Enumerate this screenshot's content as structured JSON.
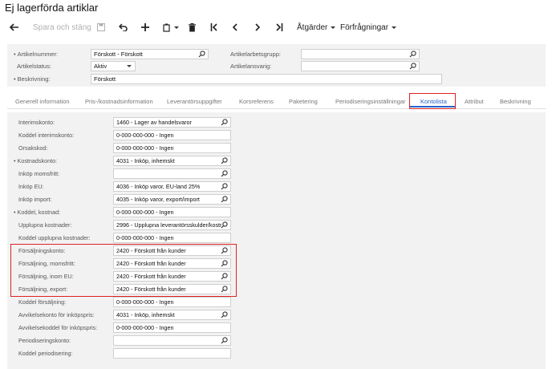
{
  "page": {
    "title": "Ej lagerförda artiklar"
  },
  "toolbar": {
    "save_close": "Spara och stäng",
    "actions": "Åtgärder",
    "inquiries": "Förfrågningar"
  },
  "header": {
    "article_number_label": "Artikelnummer:",
    "article_number_value": "Förskott - Förskott",
    "article_status_label": "Artikelstatus:",
    "article_status_value": "Aktiv",
    "description_label": "Beskrivning:",
    "description_value": "Förskott",
    "work_group_label": "Artikelarbetsgrupp:",
    "responsible_label": "Artikelansvarig:"
  },
  "tabs": [
    {
      "label": "Generell information"
    },
    {
      "label": "Pris-/kostnadsinformation"
    },
    {
      "label": "Leverantörsuppgifter"
    },
    {
      "label": "Korsreferens"
    },
    {
      "label": "Paketering"
    },
    {
      "label": "Periodiseringsinställningar"
    },
    {
      "label": "Kontolista",
      "active": true
    },
    {
      "label": "Attribut"
    },
    {
      "label": "Beskrivning"
    }
  ],
  "fields": [
    {
      "label": "Interimskonto:",
      "value": "1460 - Lager av handelsvaror",
      "search": true
    },
    {
      "label": "Koddel interimskonto:",
      "value": "0-000-000-000 - Ingen"
    },
    {
      "label": "Orsakskod:",
      "value": "0-000-000-000 - Ingen"
    },
    {
      "label": "Kostnadskonto:",
      "value": "4031 - Inköp, inhemskt",
      "search": true,
      "required": true
    },
    {
      "label": "Inköp momsfritt:",
      "value": "",
      "search": true
    },
    {
      "label": "Inköp EU:",
      "value": "4036 - Inköp varor, EU-land 25%",
      "search": true
    },
    {
      "label": "Inköp import:",
      "value": "4035 - Inköp varor, export/import",
      "search": true
    },
    {
      "label": "Koddel, kostnad:",
      "value": "0-000-000-000 - Ingen",
      "required": true
    },
    {
      "label": "Upplupna kostnader:",
      "value": "2996 - Upplupna leverantörsskulder/kostr",
      "search": true
    },
    {
      "label": "Koddel upplupna kostnader:",
      "value": "0-000-000-000 - Ingen"
    },
    {
      "label": "Försäljningskonto:",
      "value": "2420 - Förskott från kunder",
      "search": true
    },
    {
      "label": "Försäljning, momsfritt:",
      "value": "2420 - Förskott från kunder",
      "search": true
    },
    {
      "label": "Försäljning, inom EU:",
      "value": "2420 - Förskott från kunder",
      "search": true
    },
    {
      "label": "Försäljning, export:",
      "value": "2420 - Förskott från kunder",
      "search": true
    },
    {
      "label": "Koddel försäljning:",
      "value": "0-000-000-000 - Ingen"
    },
    {
      "label": "Avvikelsekonto för inköpspris:",
      "value": "4031 - Inköp, inhemskt",
      "search": true
    },
    {
      "label": "Avvikelsekoddel för inköpspris:",
      "value": "0-000-000-000 - Ingen"
    },
    {
      "label": "Periodiseringskonto:",
      "value": "",
      "search": true
    },
    {
      "label": "Koddel periodisering:",
      "value": ""
    }
  ],
  "icons": {
    "back": "back-arrow-icon",
    "save": "floppy-icon",
    "undo": "undo-icon",
    "add": "plus-icon",
    "copy": "copy-paste-icon",
    "delete": "trash-icon",
    "first": "first-record-icon",
    "prev": "previous-record-icon",
    "next": "next-record-icon",
    "last": "last-record-icon",
    "search": "search-icon"
  },
  "colors": {
    "accent": "#2a63c9",
    "highlight": "#dd2222",
    "panel": "#f2f2f2"
  }
}
